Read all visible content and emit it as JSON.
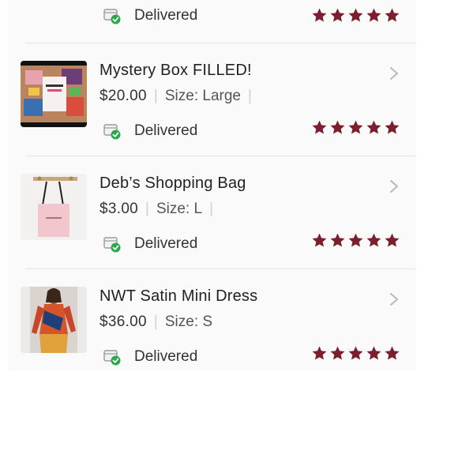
{
  "orders": [
    {
      "title": "",
      "price": "",
      "size": "",
      "status": "Delivered",
      "rating": 5
    },
    {
      "title": "Mystery Box FILLED!",
      "price": "$20.00",
      "size": "Size: Large",
      "status": "Delivered",
      "rating": 5
    },
    {
      "title": "Deb’s Shopping Bag",
      "price": "$3.00",
      "size": "Size: L",
      "status": "Delivered",
      "rating": 5
    },
    {
      "title": "NWT Satin Mini Dress",
      "price": "$36.00",
      "size": "Size: S",
      "status": "Delivered",
      "rating": 5
    }
  ],
  "colors": {
    "star": "#7b1e2e",
    "delivered_check": "#2aa84a"
  },
  "icons": {
    "status": "package-delivered-icon",
    "chevron": "chevron-right-icon",
    "star": "star-icon"
  }
}
